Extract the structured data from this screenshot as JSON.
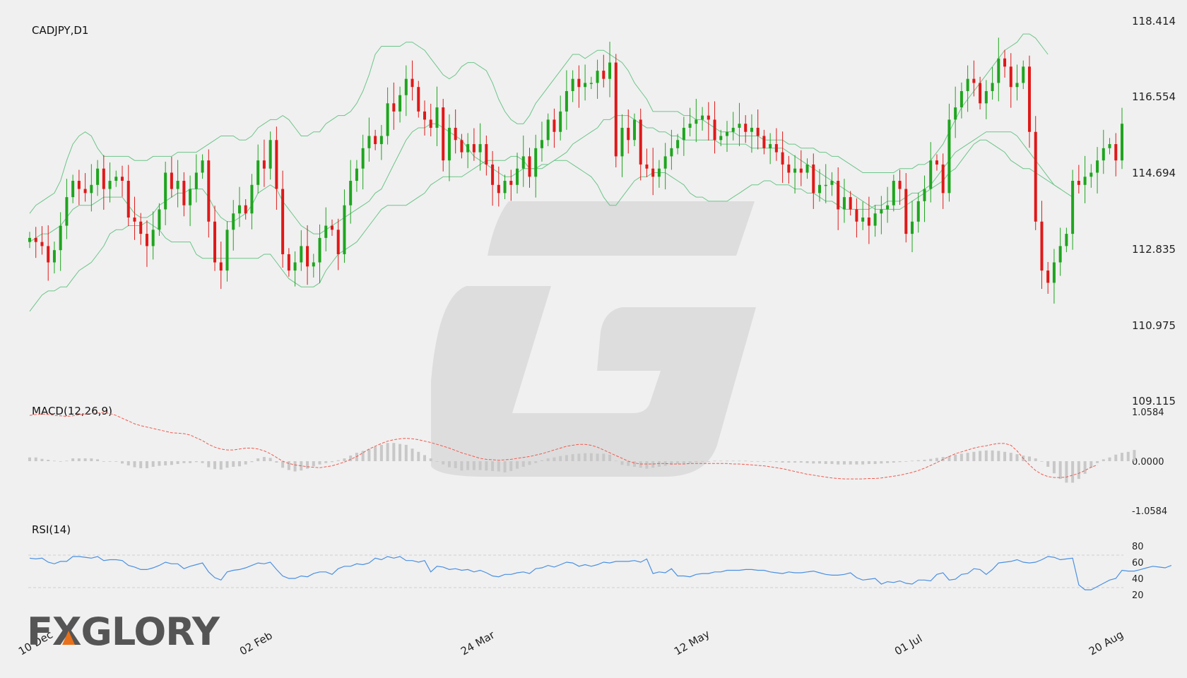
{
  "branding": {
    "logo_text": "FXGLORY",
    "accent_color": "#e8701a"
  },
  "colors": {
    "up": "#1ea51e",
    "down": "#e01818",
    "band": "#6cc58a",
    "macd_signal": "#f05a50",
    "macd_hist": "#c8c8c8",
    "rsi": "#4a90e2",
    "grid": "#c8c8c8"
  },
  "chart_data": [
    {
      "type": "candlestick",
      "title": "CADJPY,D1",
      "ylim": [
        109.115,
        118.414
      ],
      "yticks": [
        "118.414",
        "116.554",
        "114.694",
        "112.835",
        "110.975",
        "109.115"
      ],
      "xticks": [
        "10 Dec",
        "02 Feb",
        "24 Mar",
        "12 May",
        "01 Jul",
        "20 Aug"
      ],
      "xtick_index": [
        0,
        38,
        76,
        113,
        151,
        186
      ],
      "overlay": "Bollinger Bands",
      "close": [
        113.1,
        113.0,
        112.9,
        112.5,
        112.8,
        113.4,
        114.1,
        114.5,
        114.3,
        114.2,
        114.4,
        114.8,
        114.3,
        114.5,
        114.6,
        114.5,
        113.6,
        113.5,
        113.2,
        112.9,
        113.3,
        113.8,
        114.7,
        114.3,
        114.5,
        113.9,
        114.3,
        114.7,
        115.0,
        113.5,
        112.5,
        112.3,
        113.3,
        113.7,
        113.9,
        113.7,
        114.4,
        115.0,
        114.8,
        115.5,
        114.3,
        112.7,
        112.3,
        112.5,
        112.9,
        112.4,
        112.5,
        113.1,
        113.4,
        113.3,
        112.7,
        113.9,
        114.5,
        114.8,
        115.3,
        115.6,
        115.4,
        115.6,
        116.4,
        116.2,
        116.6,
        117.0,
        116.8,
        116.2,
        116.0,
        115.8,
        116.3,
        115.0,
        115.8,
        115.5,
        115.2,
        115.4,
        115.2,
        115.4,
        114.9,
        114.4,
        114.2,
        114.5,
        114.4,
        114.8,
        115.1,
        114.6,
        115.3,
        115.5,
        116.0,
        115.7,
        116.2,
        116.7,
        117.0,
        116.8,
        116.9,
        116.9,
        117.2,
        117.0,
        117.4,
        115.1,
        115.8,
        115.5,
        116.0,
        114.9,
        114.8,
        114.6,
        114.8,
        115.1,
        115.3,
        115.5,
        115.8,
        115.9,
        116.0,
        116.1,
        116.0,
        115.5,
        115.6,
        115.7,
        115.8,
        115.9,
        115.7,
        115.8,
        115.6,
        115.3,
        115.4,
        115.2,
        114.9,
        114.7,
        114.8,
        114.7,
        114.9,
        114.2,
        114.4,
        114.4,
        114.5,
        113.8,
        114.1,
        113.8,
        113.5,
        113.6,
        113.4,
        113.7,
        113.8,
        113.9,
        114.5,
        114.3,
        113.2,
        113.5,
        114.0,
        114.3,
        115.0,
        114.9,
        114.2,
        116.0,
        116.3,
        116.7,
        117.0,
        116.9,
        116.4,
        116.7,
        116.9,
        117.5,
        117.3,
        116.8,
        116.9,
        117.3,
        115.7,
        113.5,
        112.3,
        112.0,
        112.5,
        112.9,
        113.2,
        114.5,
        114.4,
        114.6,
        114.7,
        115.0,
        115.3,
        115.4,
        115.0,
        115.9
      ],
      "upper_band": [
        113.7,
        113.9,
        114.0,
        114.1,
        114.2,
        114.5,
        115.0,
        115.4,
        115.6,
        115.7,
        115.6,
        115.3,
        115.1,
        115.1,
        115.1,
        115.1,
        115.1,
        115.0,
        115.0,
        115.0,
        115.1,
        115.1,
        115.1,
        115.1,
        115.2,
        115.2,
        115.2,
        115.2,
        115.3,
        115.4,
        115.5,
        115.6,
        115.6,
        115.6,
        115.5,
        115.5,
        115.6,
        115.8,
        115.9,
        116.0,
        116.0,
        116.1,
        116.0,
        115.8,
        115.6,
        115.6,
        115.7,
        115.7,
        115.9,
        116.0,
        116.1,
        116.1,
        116.2,
        116.4,
        116.7,
        117.1,
        117.6,
        117.8,
        117.8,
        117.8,
        117.8,
        117.9,
        117.9,
        117.8,
        117.7,
        117.5,
        117.3,
        117.1,
        117.0,
        117.1,
        117.3,
        117.4,
        117.4,
        117.3,
        117.2,
        116.9,
        116.5,
        116.2,
        116.0,
        115.9,
        115.9,
        116.1,
        116.4,
        116.6,
        116.8,
        117.0,
        117.2,
        117.4,
        117.6,
        117.6,
        117.5,
        117.6,
        117.7,
        117.7,
        117.6,
        117.5,
        117.4,
        117.2,
        116.9,
        116.7,
        116.5,
        116.2,
        116.2,
        116.2,
        116.2,
        116.2,
        116.1,
        116.1,
        116.0,
        116.0,
        115.9,
        115.8,
        115.7,
        115.7,
        115.7,
        115.6,
        115.6,
        115.6,
        115.6,
        115.5,
        115.5,
        115.5,
        115.5,
        115.4,
        115.4,
        115.3,
        115.3,
        115.3,
        115.2,
        115.2,
        115.1,
        115.1,
        115.0,
        114.9,
        114.8,
        114.7,
        114.7,
        114.7,
        114.7,
        114.7,
        114.7,
        114.8,
        114.8,
        114.8,
        114.9,
        114.9,
        115.0,
        115.2,
        115.4,
        115.7,
        116.0,
        116.3,
        116.5,
        116.7,
        116.9,
        117.1,
        117.3,
        117.5,
        117.7,
        117.8,
        117.9,
        118.1,
        118.1,
        118.0,
        117.8,
        117.6
      ],
      "middle_band": [
        113.0,
        113.1,
        113.2,
        113.2,
        113.3,
        113.4,
        113.6,
        113.8,
        113.9,
        113.9,
        113.9,
        114.0,
        114.1,
        114.1,
        114.1,
        114.1,
        113.9,
        113.7,
        113.6,
        113.6,
        113.7,
        113.9,
        114.0,
        114.1,
        114.2,
        114.2,
        114.3,
        114.3,
        114.3,
        114.1,
        113.8,
        113.6,
        113.5,
        113.5,
        113.6,
        113.7,
        113.9,
        114.2,
        114.3,
        114.4,
        114.3,
        114.0,
        113.8,
        113.6,
        113.4,
        113.3,
        113.2,
        113.2,
        113.3,
        113.4,
        113.5,
        113.6,
        113.7,
        113.8,
        113.9,
        114.0,
        114.2,
        114.3,
        114.6,
        114.9,
        115.2,
        115.5,
        115.7,
        115.8,
        115.8,
        115.9,
        115.9,
        115.8,
        115.7,
        115.6,
        115.5,
        115.3,
        115.1,
        115.0,
        114.9,
        114.8,
        114.7,
        114.6,
        114.6,
        114.7,
        114.8,
        114.8,
        114.8,
        114.9,
        114.9,
        115.0,
        115.1,
        115.2,
        115.4,
        115.5,
        115.6,
        115.7,
        115.8,
        116.0,
        116.0,
        116.1,
        116.1,
        116.1,
        116.0,
        115.9,
        115.8,
        115.8,
        115.7,
        115.7,
        115.6,
        115.6,
        115.5,
        115.5,
        115.5,
        115.5,
        115.5,
        115.5,
        115.4,
        115.4,
        115.4,
        115.4,
        115.4,
        115.3,
        115.3,
        115.3,
        115.3,
        115.3,
        115.3,
        115.2,
        115.1,
        115.0,
        114.9,
        114.8,
        114.7,
        114.6,
        114.5,
        114.4,
        114.3,
        114.2,
        114.1,
        114.0,
        113.9,
        113.8,
        113.8,
        113.8,
        113.8,
        113.8,
        113.9,
        114.0,
        114.1,
        114.2,
        114.3,
        114.4,
        114.5,
        114.7,
        114.8,
        115.0,
        115.2,
        115.4,
        115.5,
        115.5,
        115.4,
        115.3,
        115.2,
        115.0,
        114.9,
        114.8,
        114.8,
        114.7,
        114.6,
        114.5,
        114.4,
        114.3
      ],
      "lower_band": [
        111.3,
        111.5,
        111.7,
        111.8,
        111.8,
        111.9,
        111.9,
        112.1,
        112.3,
        112.4,
        112.5,
        112.7,
        112.9,
        113.2,
        113.3,
        113.3,
        113.4,
        113.4,
        113.4,
        113.5,
        113.4,
        113.3,
        113.1,
        113.0,
        113.0,
        113.0,
        113.0,
        112.7,
        112.6,
        112.6,
        112.6,
        112.6,
        112.6,
        112.6,
        112.6,
        112.6,
        112.6,
        112.6,
        112.7,
        112.7,
        112.5,
        112.3,
        112.1,
        112.0,
        111.9,
        111.9,
        111.9,
        112.0,
        112.3,
        112.5,
        112.7,
        112.8,
        112.9,
        113.0,
        113.2,
        113.4,
        113.6,
        113.8,
        113.9,
        113.9,
        113.9,
        113.9,
        114.0,
        114.1,
        114.2,
        114.4,
        114.5,
        114.6,
        114.6,
        114.6,
        114.6,
        114.7,
        114.8,
        114.9,
        115.0,
        115.0,
        115.0,
        115.0,
        115.1,
        115.1,
        115.0,
        114.8,
        114.8,
        114.8,
        114.9,
        115.0,
        115.0,
        115.0,
        114.9,
        114.8,
        114.7,
        114.6,
        114.4,
        114.1,
        113.9,
        113.9,
        114.1,
        114.3,
        114.5,
        114.6,
        114.6,
        114.7,
        114.7,
        114.7,
        114.6,
        114.5,
        114.4,
        114.2,
        114.1,
        114.1,
        114.0,
        114.0,
        114.0,
        114.0,
        114.1,
        114.2,
        114.3,
        114.4,
        114.4,
        114.5,
        114.5,
        114.4,
        114.4,
        114.4,
        114.3,
        114.3,
        114.2,
        114.2,
        114.1,
        114.0,
        114.0,
        113.9,
        113.8,
        113.8,
        113.8,
        113.8,
        113.8,
        113.9,
        113.9,
        114.0,
        114.0,
        114.0,
        114.1,
        114.2,
        114.2,
        114.3,
        114.4,
        114.6,
        114.8,
        115.0,
        115.2,
        115.3,
        115.4,
        115.5,
        115.6,
        115.7,
        115.7,
        115.7,
        115.7,
        115.7,
        115.6,
        115.4,
        115.2,
        115.0,
        114.8,
        114.6,
        114.4,
        114.3,
        114.2,
        114.1
      ]
    },
    {
      "type": "line",
      "title": "MACD(12,26,9)",
      "ylim": [
        -1.0584,
        1.0584
      ],
      "yticks": [
        "1.0584",
        "0.0000",
        "-1.0584"
      ],
      "signal": [
        0.98,
        1.0,
        1.01,
        1.0,
        0.98,
        0.97,
        0.96,
        0.97,
        0.99,
        1.01,
        1.02,
        1.03,
        1.04,
        1.02,
        0.98,
        0.92,
        0.86,
        0.8,
        0.76,
        0.73,
        0.7,
        0.67,
        0.64,
        0.61,
        0.6,
        0.59,
        0.56,
        0.5,
        0.44,
        0.36,
        0.3,
        0.26,
        0.24,
        0.24,
        0.26,
        0.28,
        0.28,
        0.26,
        0.22,
        0.16,
        0.08,
        0.0,
        -0.05,
        -0.08,
        -0.1,
        -0.12,
        -0.13,
        -0.14,
        -0.12,
        -0.1,
        -0.06,
        -0.02,
        0.04,
        0.1,
        0.18,
        0.26,
        0.32,
        0.38,
        0.43,
        0.46,
        0.48,
        0.49,
        0.48,
        0.46,
        0.43,
        0.4,
        0.36,
        0.32,
        0.28,
        0.23,
        0.18,
        0.14,
        0.1,
        0.06,
        0.04,
        0.03,
        0.02,
        0.03,
        0.04,
        0.06,
        0.08,
        0.1,
        0.13,
        0.16,
        0.2,
        0.24,
        0.28,
        0.32,
        0.34,
        0.36,
        0.36,
        0.34,
        0.3,
        0.24,
        0.18,
        0.12,
        0.06,
        0.0,
        -0.04,
        -0.06,
        -0.06,
        -0.06,
        -0.05,
        -0.05,
        -0.06,
        -0.06,
        -0.06,
        -0.05,
        -0.05,
        -0.05,
        -0.05,
        -0.05,
        -0.05,
        -0.05,
        -0.06,
        -0.06,
        -0.07,
        -0.08,
        -0.09,
        -0.1,
        -0.12,
        -0.14,
        -0.16,
        -0.19,
        -0.22,
        -0.25,
        -0.28,
        -0.3,
        -0.32,
        -0.34,
        -0.36,
        -0.37,
        -0.38,
        -0.38,
        -0.38,
        -0.38,
        -0.37,
        -0.37,
        -0.36,
        -0.34,
        -0.32,
        -0.3,
        -0.27,
        -0.24,
        -0.2,
        -0.15,
        -0.09,
        -0.03,
        0.04,
        0.1,
        0.16,
        0.2,
        0.24,
        0.28,
        0.31,
        0.33,
        0.36,
        0.38,
        0.38,
        0.34,
        0.22,
        0.06,
        -0.08,
        -0.2,
        -0.28,
        -0.33,
        -0.35,
        -0.35,
        -0.34,
        -0.3,
        -0.26,
        -0.2,
        -0.13,
        -0.08
      ],
      "histogram": [
        0.08,
        0.08,
        0.05,
        0.03,
        0.01,
        -0.01,
        0.01,
        0.06,
        0.06,
        0.06,
        0.06,
        0.04,
        0.0,
        0.0,
        -0.01,
        -0.05,
        -0.09,
        -0.13,
        -0.15,
        -0.15,
        -0.12,
        -0.1,
        -0.09,
        -0.08,
        -0.06,
        -0.04,
        -0.04,
        -0.02,
        -0.04,
        -0.13,
        -0.17,
        -0.18,
        -0.14,
        -0.12,
        -0.11,
        -0.07,
        -0.02,
        0.06,
        0.09,
        0.07,
        -0.03,
        -0.14,
        -0.19,
        -0.22,
        -0.2,
        -0.16,
        -0.11,
        -0.07,
        -0.04,
        -0.02,
        0.02,
        0.06,
        0.12,
        0.18,
        0.22,
        0.26,
        0.31,
        0.35,
        0.39,
        0.39,
        0.37,
        0.35,
        0.27,
        0.2,
        0.13,
        0.06,
        -0.01,
        -0.07,
        -0.13,
        -0.15,
        -0.2,
        -0.19,
        -0.19,
        -0.19,
        -0.2,
        -0.21,
        -0.22,
        -0.24,
        -0.21,
        -0.16,
        -0.12,
        -0.08,
        -0.04,
        0.02,
        0.06,
        0.08,
        0.11,
        0.13,
        0.15,
        0.16,
        0.17,
        0.17,
        0.16,
        0.16,
        0.14,
        0.01,
        -0.08,
        -0.1,
        -0.12,
        -0.14,
        -0.16,
        -0.14,
        -0.12,
        -0.1,
        -0.08,
        -0.06,
        -0.05,
        -0.04,
        -0.02,
        -0.01,
        0.0,
        0.01,
        0.01,
        0.01,
        0.01,
        0.01,
        0.01,
        0.0,
        0.0,
        0.0,
        -0.01,
        -0.02,
        -0.03,
        -0.03,
        -0.03,
        -0.03,
        -0.04,
        -0.05,
        -0.05,
        -0.06,
        -0.06,
        -0.07,
        -0.07,
        -0.07,
        -0.07,
        -0.07,
        -0.06,
        -0.06,
        -0.05,
        -0.04,
        -0.03,
        -0.02,
        -0.01,
        0.01,
        0.02,
        0.03,
        0.05,
        0.07,
        0.09,
        0.11,
        0.14,
        0.16,
        0.18,
        0.2,
        0.22,
        0.23,
        0.23,
        0.22,
        0.2,
        0.18,
        0.15,
        0.12,
        0.1,
        0.06,
        0.0,
        -0.12,
        -0.26,
        -0.38,
        -0.46,
        -0.46,
        -0.38,
        -0.27,
        -0.14,
        -0.04,
        0.04,
        0.08,
        0.14,
        0.18,
        0.2,
        0.24
      ]
    },
    {
      "type": "line",
      "title": "RSI(14)",
      "ylim": [
        20,
        80
      ],
      "yticks": [
        "80",
        "60",
        "40",
        "20"
      ],
      "levels": [
        70,
        30
      ],
      "values": [
        65,
        64,
        65,
        60,
        58,
        61,
        61,
        67,
        67,
        66,
        65,
        67,
        62,
        63,
        63,
        62,
        56,
        54,
        51,
        51,
        53,
        56,
        60,
        58,
        58,
        52,
        55,
        57,
        59,
        48,
        41,
        38,
        48,
        50,
        51,
        53,
        56,
        59,
        58,
        60,
        51,
        43,
        40,
        40,
        43,
        42,
        46,
        48,
        48,
        45,
        52,
        55,
        55,
        58,
        57,
        59,
        65,
        63,
        67,
        65,
        67,
        62,
        62,
        60,
        62,
        48,
        55,
        54,
        51,
        52,
        50,
        51,
        48,
        50,
        47,
        43,
        42,
        45,
        45,
        47,
        48,
        46,
        52,
        53,
        56,
        54,
        57,
        60,
        59,
        55,
        57,
        55,
        57,
        60,
        59,
        61,
        61,
        61,
        62,
        60,
        64,
        46,
        48,
        47,
        52,
        43,
        43,
        42,
        45,
        46,
        46,
        48,
        48,
        50,
        50,
        50,
        51,
        51,
        50,
        50,
        48,
        47,
        46,
        48,
        47,
        47,
        48,
        49,
        47,
        45,
        44,
        44,
        45,
        47,
        41,
        38,
        39,
        40,
        33,
        36,
        35,
        37,
        34,
        33,
        38,
        38,
        37,
        45,
        47,
        38,
        39,
        45,
        46,
        52,
        51,
        45,
        51,
        59,
        60,
        61,
        63,
        60,
        59,
        60,
        63,
        67,
        66,
        63,
        64,
        65,
        32,
        26,
        26,
        30,
        34,
        38,
        40,
        50,
        49,
        49,
        51,
        53,
        55,
        54,
        53,
        56
      ]
    }
  ]
}
